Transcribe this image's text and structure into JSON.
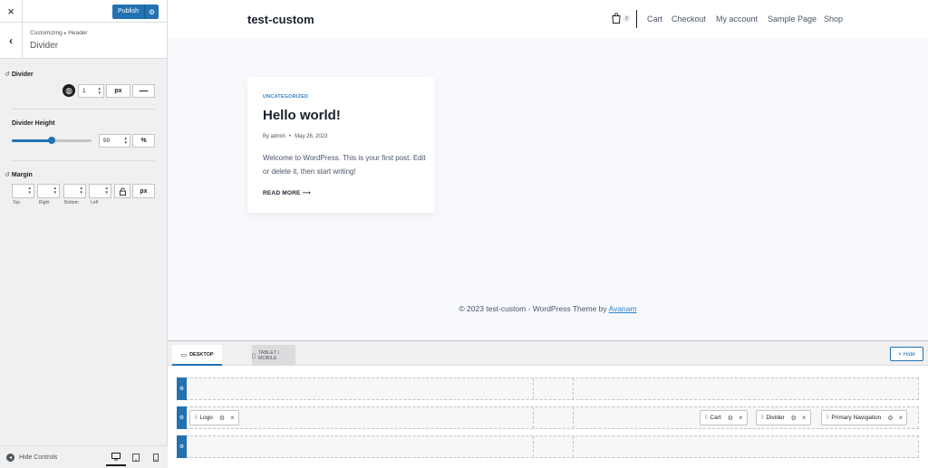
{
  "sidebar": {
    "close_icon": "×",
    "publish_label": "Publish",
    "publish_gear": "⚙",
    "back_icon": "‹",
    "breadcrumb": [
      "Customizing",
      "Header"
    ],
    "breadcrumb_sep": "▸",
    "title": "Divider",
    "divider": {
      "label": "Divider",
      "reset_icon": "↺",
      "globe_icon": "◍",
      "width_value": "1",
      "width_unit": "px",
      "style_icon": "—"
    },
    "divider_height": {
      "label": "Divider Height",
      "value": "50",
      "unit": "%",
      "slider_level": 0.5
    },
    "margin": {
      "label": "Margin",
      "reset_icon": "↺",
      "unit": "px",
      "lock_icon": "🔓",
      "fields": [
        {
          "caption": "Top",
          "value": ""
        },
        {
          "caption": "Right",
          "value": ""
        },
        {
          "caption": "Bottom",
          "value": ""
        },
        {
          "caption": "Left",
          "value": ""
        }
      ]
    },
    "footer": {
      "hide_controls": "Hide Controls",
      "hide_icon": "◂",
      "devices": [
        "desktop-icon",
        "tablet-icon",
        "mobile-icon"
      ]
    }
  },
  "preview": {
    "site_title": "test-custom",
    "cart_count": "0",
    "nav": [
      "Cart",
      "Checkout",
      "My account",
      "Sample Page",
      "Shop"
    ],
    "post": {
      "category": "UNCATEGORIZED",
      "title": "Hello world!",
      "author": "By admin",
      "date": "May 26, 2023",
      "excerpt": "Welcome to WordPress. This is your first post. Edit or delete it, then start writing!",
      "read_more": "READ MORE ⟶"
    },
    "footer_text": "© 2023 test-custom - WordPress Theme by",
    "footer_link": "Avanam"
  },
  "builder": {
    "tab_desktop": "DESKTOP",
    "tab_tablet": "TABLET / MOBILE",
    "hide_label": "× Hide",
    "row_gear": "⚙",
    "chips_left": [
      {
        "label": "Logo"
      }
    ],
    "chips_right": [
      {
        "label": "Cart"
      },
      {
        "label": "Divider"
      },
      {
        "label": "Primary Navigation"
      }
    ],
    "drag_icon": "⠿",
    "gear_icon": "⚙",
    "close_icon": "×"
  },
  "colors": {
    "accent": "#2271b1",
    "link": "#3182ce"
  }
}
